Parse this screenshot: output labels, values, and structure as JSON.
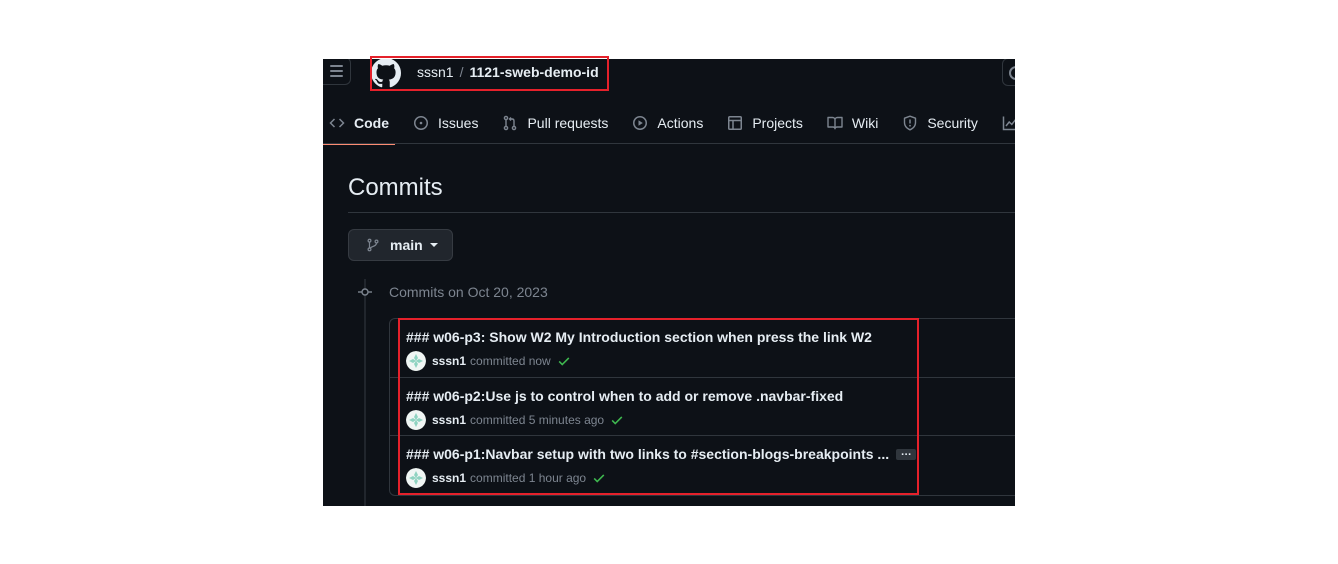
{
  "header": {
    "owner": "sssn1",
    "separator": "/",
    "repo": "1121-sweb-demo-id"
  },
  "tabs": [
    {
      "label": "Code",
      "icon": "code-icon",
      "active": true
    },
    {
      "label": "Issues",
      "icon": "issue-opened-icon"
    },
    {
      "label": "Pull requests",
      "icon": "git-pull-request-icon"
    },
    {
      "label": "Actions",
      "icon": "play-icon"
    },
    {
      "label": "Projects",
      "icon": "table-icon"
    },
    {
      "label": "Wiki",
      "icon": "book-icon"
    },
    {
      "label": "Security",
      "icon": "shield-icon"
    }
  ],
  "page": {
    "title": "Commits",
    "branch": "main",
    "group_label": "Commits on Oct 20, 2023"
  },
  "commits": [
    {
      "title": "### w06-p3: Show W2 My Introduction section when press the link W2",
      "author": "sssn1",
      "time": "committed now",
      "status": "success"
    },
    {
      "title": "### w06-p2:Use js to control when to add or remove .navbar-fixed",
      "author": "sssn1",
      "time": "committed 5 minutes ago",
      "status": "success"
    },
    {
      "title": "### w06-p1:Navbar setup with two links to #section-blogs-breakpoints ...",
      "author": "sssn1",
      "time": "committed 1 hour ago",
      "status": "success",
      "truncated": true
    }
  ],
  "colors": {
    "background": "#0d1117",
    "accent_underline": "#fd8c73",
    "success": "#3fb950",
    "highlight_annotation": "#e5212b"
  }
}
